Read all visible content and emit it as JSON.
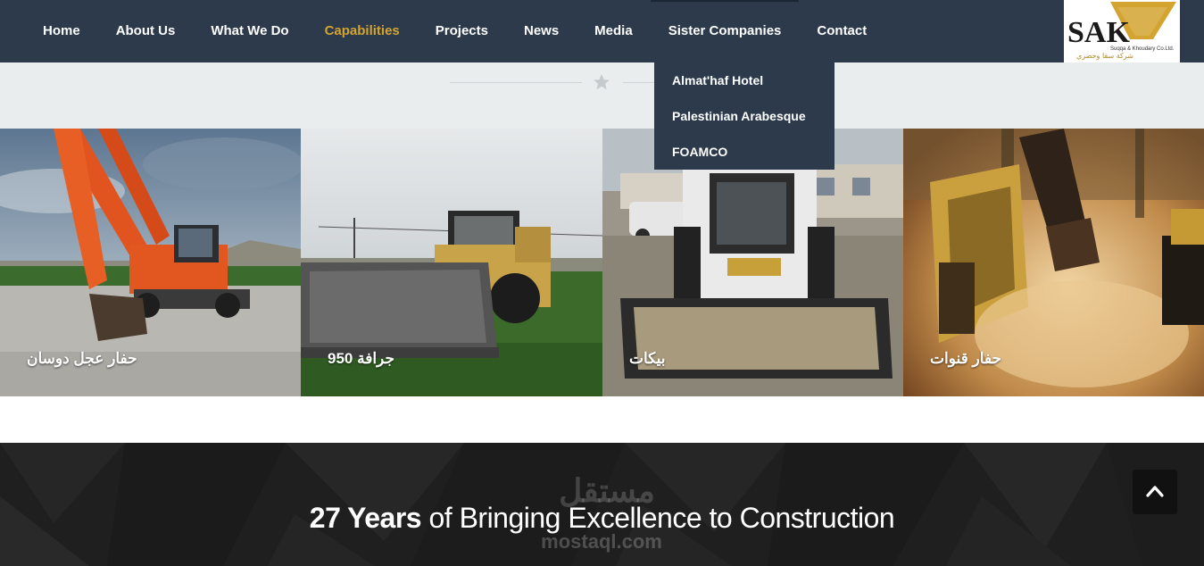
{
  "nav": {
    "items": [
      {
        "label": "Home",
        "active": false
      },
      {
        "label": "About Us",
        "active": false
      },
      {
        "label": "What We Do",
        "active": false
      },
      {
        "label": "Capabilities",
        "active": true
      },
      {
        "label": "Projects",
        "active": false
      },
      {
        "label": "News",
        "active": false
      },
      {
        "label": "Media",
        "active": false
      },
      {
        "label": "Sister Companies",
        "active": false
      },
      {
        "label": "Contact",
        "active": false
      }
    ],
    "accent_color": "#d4a431",
    "background_color": "#2c3a4c"
  },
  "logo": {
    "mark": "SAK",
    "company_en": "Suqqa & Khoudary Co.Ltd.",
    "company_ar": "شركة سقا وخضري"
  },
  "dropdown": {
    "items": [
      "Almat'haf Hotel",
      "Palestinian Arabesque",
      "FOAMCO"
    ]
  },
  "divider": {
    "icon": "star-icon"
  },
  "gallery": [
    {
      "caption": "حفار عجل دوسان",
      "icon": "wheel-excavator-photo"
    },
    {
      "caption": "جرافة 950",
      "icon": "wheel-loader-photo"
    },
    {
      "caption": "بيكات",
      "icon": "skid-steer-photo"
    },
    {
      "caption": "حفار قنوات",
      "icon": "trencher-photo"
    }
  ],
  "banner": {
    "headline_bold": "27 Years",
    "headline_rest": " of Bringing Excellence to Construction",
    "watermark": "مستقل",
    "watermark_sub": "mostaql.com"
  },
  "back_to_top": {
    "icon": "chevron-up-icon"
  }
}
